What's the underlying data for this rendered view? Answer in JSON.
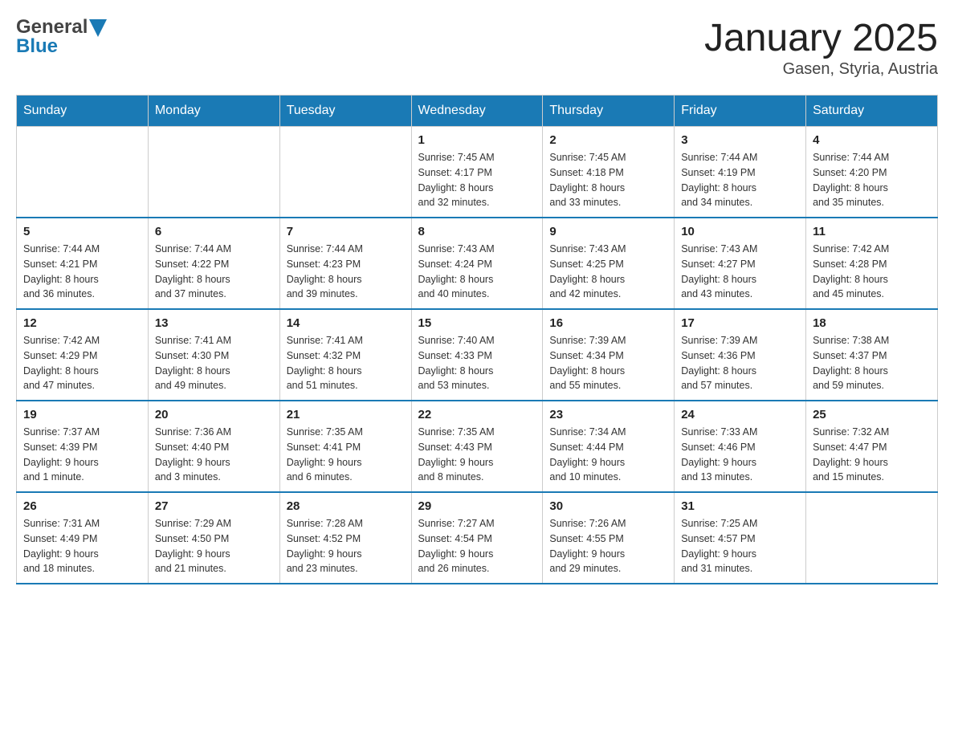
{
  "header": {
    "logo_text_general": "General",
    "logo_text_blue": "Blue",
    "month_year": "January 2025",
    "location": "Gasen, Styria, Austria"
  },
  "weekdays": [
    "Sunday",
    "Monday",
    "Tuesday",
    "Wednesday",
    "Thursday",
    "Friday",
    "Saturday"
  ],
  "weeks": [
    [
      {
        "day": "",
        "info": ""
      },
      {
        "day": "",
        "info": ""
      },
      {
        "day": "",
        "info": ""
      },
      {
        "day": "1",
        "info": "Sunrise: 7:45 AM\nSunset: 4:17 PM\nDaylight: 8 hours\nand 32 minutes."
      },
      {
        "day": "2",
        "info": "Sunrise: 7:45 AM\nSunset: 4:18 PM\nDaylight: 8 hours\nand 33 minutes."
      },
      {
        "day": "3",
        "info": "Sunrise: 7:44 AM\nSunset: 4:19 PM\nDaylight: 8 hours\nand 34 minutes."
      },
      {
        "day": "4",
        "info": "Sunrise: 7:44 AM\nSunset: 4:20 PM\nDaylight: 8 hours\nand 35 minutes."
      }
    ],
    [
      {
        "day": "5",
        "info": "Sunrise: 7:44 AM\nSunset: 4:21 PM\nDaylight: 8 hours\nand 36 minutes."
      },
      {
        "day": "6",
        "info": "Sunrise: 7:44 AM\nSunset: 4:22 PM\nDaylight: 8 hours\nand 37 minutes."
      },
      {
        "day": "7",
        "info": "Sunrise: 7:44 AM\nSunset: 4:23 PM\nDaylight: 8 hours\nand 39 minutes."
      },
      {
        "day": "8",
        "info": "Sunrise: 7:43 AM\nSunset: 4:24 PM\nDaylight: 8 hours\nand 40 minutes."
      },
      {
        "day": "9",
        "info": "Sunrise: 7:43 AM\nSunset: 4:25 PM\nDaylight: 8 hours\nand 42 minutes."
      },
      {
        "day": "10",
        "info": "Sunrise: 7:43 AM\nSunset: 4:27 PM\nDaylight: 8 hours\nand 43 minutes."
      },
      {
        "day": "11",
        "info": "Sunrise: 7:42 AM\nSunset: 4:28 PM\nDaylight: 8 hours\nand 45 minutes."
      }
    ],
    [
      {
        "day": "12",
        "info": "Sunrise: 7:42 AM\nSunset: 4:29 PM\nDaylight: 8 hours\nand 47 minutes."
      },
      {
        "day": "13",
        "info": "Sunrise: 7:41 AM\nSunset: 4:30 PM\nDaylight: 8 hours\nand 49 minutes."
      },
      {
        "day": "14",
        "info": "Sunrise: 7:41 AM\nSunset: 4:32 PM\nDaylight: 8 hours\nand 51 minutes."
      },
      {
        "day": "15",
        "info": "Sunrise: 7:40 AM\nSunset: 4:33 PM\nDaylight: 8 hours\nand 53 minutes."
      },
      {
        "day": "16",
        "info": "Sunrise: 7:39 AM\nSunset: 4:34 PM\nDaylight: 8 hours\nand 55 minutes."
      },
      {
        "day": "17",
        "info": "Sunrise: 7:39 AM\nSunset: 4:36 PM\nDaylight: 8 hours\nand 57 minutes."
      },
      {
        "day": "18",
        "info": "Sunrise: 7:38 AM\nSunset: 4:37 PM\nDaylight: 8 hours\nand 59 minutes."
      }
    ],
    [
      {
        "day": "19",
        "info": "Sunrise: 7:37 AM\nSunset: 4:39 PM\nDaylight: 9 hours\nand 1 minute."
      },
      {
        "day": "20",
        "info": "Sunrise: 7:36 AM\nSunset: 4:40 PM\nDaylight: 9 hours\nand 3 minutes."
      },
      {
        "day": "21",
        "info": "Sunrise: 7:35 AM\nSunset: 4:41 PM\nDaylight: 9 hours\nand 6 minutes."
      },
      {
        "day": "22",
        "info": "Sunrise: 7:35 AM\nSunset: 4:43 PM\nDaylight: 9 hours\nand 8 minutes."
      },
      {
        "day": "23",
        "info": "Sunrise: 7:34 AM\nSunset: 4:44 PM\nDaylight: 9 hours\nand 10 minutes."
      },
      {
        "day": "24",
        "info": "Sunrise: 7:33 AM\nSunset: 4:46 PM\nDaylight: 9 hours\nand 13 minutes."
      },
      {
        "day": "25",
        "info": "Sunrise: 7:32 AM\nSunset: 4:47 PM\nDaylight: 9 hours\nand 15 minutes."
      }
    ],
    [
      {
        "day": "26",
        "info": "Sunrise: 7:31 AM\nSunset: 4:49 PM\nDaylight: 9 hours\nand 18 minutes."
      },
      {
        "day": "27",
        "info": "Sunrise: 7:29 AM\nSunset: 4:50 PM\nDaylight: 9 hours\nand 21 minutes."
      },
      {
        "day": "28",
        "info": "Sunrise: 7:28 AM\nSunset: 4:52 PM\nDaylight: 9 hours\nand 23 minutes."
      },
      {
        "day": "29",
        "info": "Sunrise: 7:27 AM\nSunset: 4:54 PM\nDaylight: 9 hours\nand 26 minutes."
      },
      {
        "day": "30",
        "info": "Sunrise: 7:26 AM\nSunset: 4:55 PM\nDaylight: 9 hours\nand 29 minutes."
      },
      {
        "day": "31",
        "info": "Sunrise: 7:25 AM\nSunset: 4:57 PM\nDaylight: 9 hours\nand 31 minutes."
      },
      {
        "day": "",
        "info": ""
      }
    ]
  ]
}
